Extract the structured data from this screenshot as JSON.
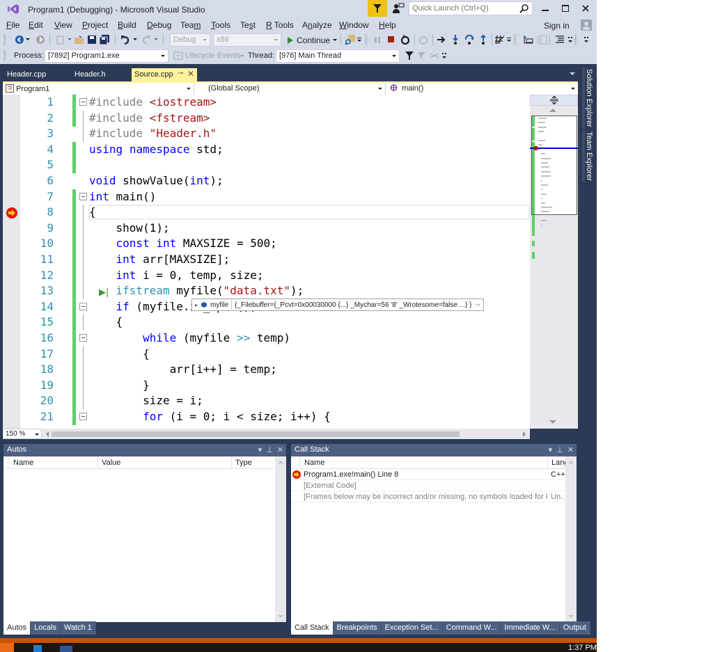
{
  "window": {
    "title": "Program1 (Debugging) - Microsoft Visual Studio",
    "quick_launch_placeholder": "Quick Launch (Ctrl+Q)",
    "sign_in": "Sign in"
  },
  "menu": [
    {
      "label": "File",
      "mnemonic": "F"
    },
    {
      "label": "Edit",
      "mnemonic": "E"
    },
    {
      "label": "View",
      "mnemonic": "V"
    },
    {
      "label": "Project",
      "mnemonic": "P"
    },
    {
      "label": "Build",
      "mnemonic": "B"
    },
    {
      "label": "Debug",
      "mnemonic": "D"
    },
    {
      "label": "Team",
      "mnemonic": "m"
    },
    {
      "label": "Tools",
      "mnemonic": "T"
    },
    {
      "label": "Test",
      "mnemonic": "s"
    },
    {
      "label": "R Tools",
      "mnemonic": "R"
    },
    {
      "label": "Analyze",
      "mnemonic": "n"
    },
    {
      "label": "Window",
      "mnemonic": "W"
    },
    {
      "label": "Help",
      "mnemonic": "H"
    }
  ],
  "toolbar": {
    "config": "Debug",
    "platform": "x86",
    "continue_label": "Continue",
    "process_label": "Process:",
    "process_value": "[7892] Program1.exe",
    "lifecycle_label": "Lifecycle Events",
    "thread_label": "Thread:",
    "thread_value": "[976] Main Thread"
  },
  "doc_tabs": [
    {
      "label": "Header.cpp",
      "active": false
    },
    {
      "label": "Header.h",
      "active": false
    },
    {
      "label": "Source.cpp",
      "active": true
    }
  ],
  "navbar": {
    "project": "Program1",
    "scope": "(Global Scope)",
    "member": "main()"
  },
  "editor": {
    "zoom": "150 %",
    "current_line": 8,
    "lines": [
      {
        "n": "1",
        "html": "<span class=\"pp\">#include</span> <span class=\"str\">&lt;iostream&gt;</span>"
      },
      {
        "n": "2",
        "html": "<span class=\"pp\">#include</span> <span class=\"str\">&lt;fstream&gt;</span>"
      },
      {
        "n": "3",
        "html": "<span class=\"pp\">#include</span> <span class=\"str\">\"Header.h\"</span>"
      },
      {
        "n": "4",
        "html": "<span class=\"kw\">using</span> <span class=\"kw\">namespace</span> std;"
      },
      {
        "n": "5",
        "html": ""
      },
      {
        "n": "6",
        "html": "<span class=\"kw\">void</span> showValue(<span class=\"kw\">int</span>);"
      },
      {
        "n": "7",
        "html": "<span class=\"kw\">int</span> main()"
      },
      {
        "n": "8",
        "html": "{"
      },
      {
        "n": "9",
        "html": "    show(1);"
      },
      {
        "n": "10",
        "html": "    <span class=\"kw\">const</span> <span class=\"kw\">int</span> MAXSIZE = 500;"
      },
      {
        "n": "11",
        "html": "    <span class=\"kw\">int</span> arr[MAXSIZE];"
      },
      {
        "n": "12",
        "html": "    <span class=\"kw\">int</span> i = 0, temp, size;"
      },
      {
        "n": "13",
        "html": "    <span class=\"ty\">ifstream</span> myfile(<span class=\"str\">\"data.txt\"</span>);"
      },
      {
        "n": "14",
        "html": "    <span class=\"kw\">if</span> (myfile.is_open())"
      },
      {
        "n": "15",
        "html": "    {"
      },
      {
        "n": "16",
        "html": "        <span class=\"kw\">while</span> (myfile <span class=\"ty\">&gt;&gt;</span> temp)"
      },
      {
        "n": "17",
        "html": "        {"
      },
      {
        "n": "18",
        "html": "            arr[i++] = temp;"
      },
      {
        "n": "19",
        "html": "        }"
      },
      {
        "n": "20",
        "html": "        size = i;"
      },
      {
        "n": "21",
        "html": "        <span class=\"kw\">for</span> (i = 0; i &lt; size; i++) {"
      }
    ],
    "datatip": {
      "name": "myfile",
      "value": "{_Filebuffer={_Pcvt=0x00030000 {...} _Mychar=56 '8' _Wrotesome=false ...} }"
    }
  },
  "side_tabs": [
    "Solution Explorer",
    "Team Explorer"
  ],
  "autos": {
    "title": "Autos",
    "columns": [
      "Name",
      "Value",
      "Type"
    ],
    "rows": [],
    "tabs": [
      {
        "label": "Autos",
        "active": true
      },
      {
        "label": "Locals",
        "active": false
      },
      {
        "label": "Watch 1",
        "active": false
      }
    ]
  },
  "callstack": {
    "title": "Call Stack",
    "columns": [
      "Name",
      "Lang"
    ],
    "rows": [
      {
        "name": "Program1.exe!main() Line 8",
        "lang": "C++",
        "current": true
      },
      {
        "name": "[External Code]",
        "lang": "",
        "current": false
      },
      {
        "name": "[Frames below may be incorrect and/or missing, no symbols loaded for k...",
        "lang": "Un...",
        "current": false
      }
    ],
    "tabs": [
      {
        "label": "Call Stack",
        "active": true
      },
      {
        "label": "Breakpoints",
        "active": false
      },
      {
        "label": "Exception Set...",
        "active": false
      },
      {
        "label": "Command W...",
        "active": false
      },
      {
        "label": "Immediate W...",
        "active": false
      },
      {
        "label": "Output",
        "active": false
      }
    ]
  },
  "taskbar": {
    "clock": "1:37 PM"
  },
  "colors": {
    "status_bar": "#ca5100",
    "active_tab": "#fff29d",
    "chrome": "#d6dbe9",
    "frame": "#2b3a55"
  }
}
